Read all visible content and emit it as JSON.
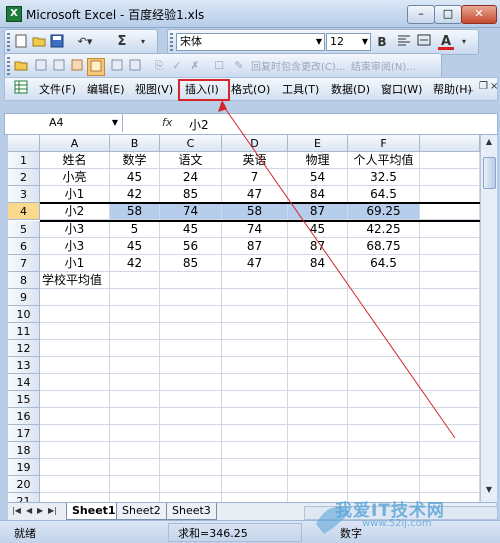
{
  "window": {
    "title": "Microsoft Excel - 百度经验1.xls",
    "min": "–",
    "max": "□",
    "close": "✕"
  },
  "toolbar1": {
    "sum_symbol": "Σ"
  },
  "toolbar2": {
    "font_name": "宋体",
    "font_size": "12",
    "bold": "B",
    "font_color": "A"
  },
  "toolbar3": {
    "reply_text": "回复时包含更改(C)...",
    "end_review": "结束审阅(N)..."
  },
  "menu": {
    "items": [
      "文件(F)",
      "编辑(E)",
      "视图(V)",
      "插入(I)",
      "格式(O)",
      "工具(T)",
      "数据(D)",
      "窗口(W)",
      "帮助(H)"
    ]
  },
  "formula_bar": {
    "cell_ref": "A4",
    "fx": "fx",
    "value": "小2"
  },
  "sheet": {
    "columns": [
      "A",
      "B",
      "C",
      "D",
      "E",
      "F"
    ],
    "row_numbers": [
      "1",
      "2",
      "3",
      "4",
      "5",
      "6",
      "7",
      "8",
      "9",
      "10",
      "11",
      "12",
      "13",
      "14",
      "15",
      "16",
      "17",
      "18",
      "19",
      "20",
      "21"
    ],
    "rows": [
      [
        "姓名",
        "数学",
        "语文",
        "英语",
        "物理",
        "个人平均值"
      ],
      [
        "小亮",
        "45",
        "24",
        "7",
        "54",
        "32.5"
      ],
      [
        "小1",
        "42",
        "85",
        "47",
        "84",
        "64.5"
      ],
      [
        "小2",
        "58",
        "74",
        "58",
        "87",
        "69.25"
      ],
      [
        "小3",
        "5",
        "45",
        "74",
        "45",
        "42.25"
      ],
      [
        "小3",
        "45",
        "56",
        "87",
        "87",
        "68.75"
      ],
      [
        "小1",
        "42",
        "85",
        "47",
        "84",
        "64.5"
      ],
      [
        "学校平均值",
        "",
        "",
        "",
        "",
        ""
      ]
    ],
    "selected_row": "4"
  },
  "tabs": [
    "Sheet1",
    "Sheet2",
    "Sheet3"
  ],
  "status": {
    "ready": "就绪",
    "sum": "求和=346.25",
    "mode": "数字"
  },
  "watermark": {
    "main": "我爱IT技术网",
    "sub": "www.52ij.com"
  },
  "colors": {
    "annotation": "#d6262b",
    "selection": "#b6cdec",
    "watermark": "#5fa7d9"
  }
}
